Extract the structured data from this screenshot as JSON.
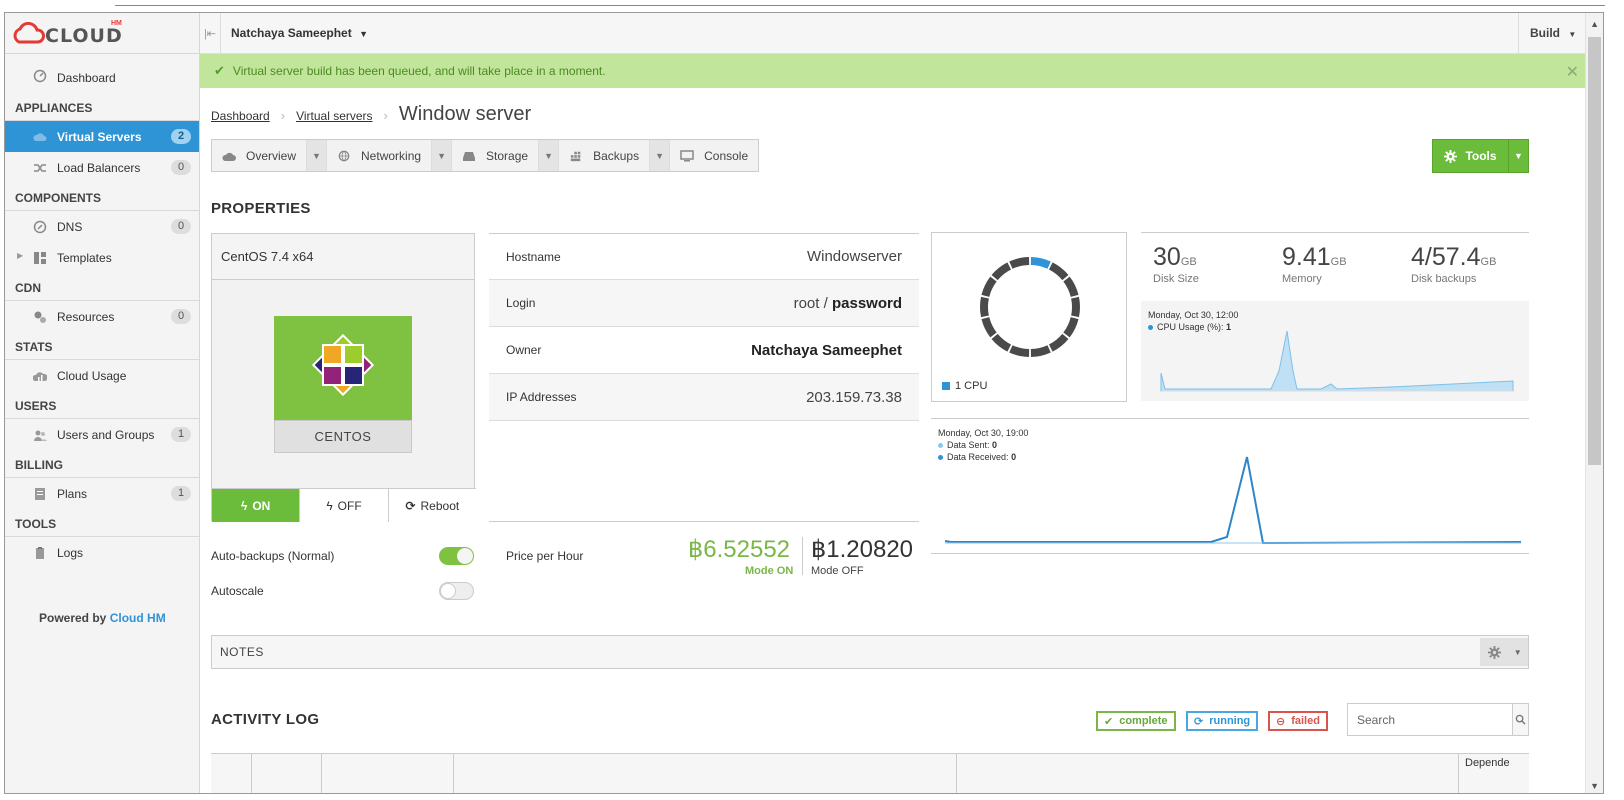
{
  "brand": {
    "name": "CLOUD",
    "superscript": "HM"
  },
  "topbar": {
    "user": "Natchaya Sameephet",
    "build": "Build"
  },
  "sidebar": {
    "dashboard": "Dashboard",
    "sections": {
      "appliances": "APPLIANCES",
      "components": "COMPONENTS",
      "cdn": "CDN",
      "stats": "STATS",
      "users": "USERS",
      "billing": "BILLING",
      "tools": "TOOLS"
    },
    "items": {
      "virtual_servers": {
        "label": "Virtual Servers",
        "count": "2"
      },
      "load_balancers": {
        "label": "Load Balancers",
        "count": "0"
      },
      "dns": {
        "label": "DNS",
        "count": "0"
      },
      "templates": {
        "label": "Templates"
      },
      "resources": {
        "label": "Resources",
        "count": "0"
      },
      "cloud_usage": {
        "label": "Cloud Usage"
      },
      "users_groups": {
        "label": "Users and Groups",
        "count": "1"
      },
      "plans": {
        "label": "Plans",
        "count": "1"
      },
      "logs": {
        "label": "Logs"
      }
    },
    "powered_prefix": "Powered by",
    "powered_link": "Cloud HM"
  },
  "alert": {
    "message": "Virtual server build has been queued, and will take place in a moment."
  },
  "breadcrumb": {
    "dashboard": "Dashboard",
    "virtual_servers": "Virtual servers",
    "current": "Window server"
  },
  "tabs": {
    "overview": "Overview",
    "networking": "Networking",
    "storage": "Storage",
    "backups": "Backups",
    "console": "Console"
  },
  "tools_label": "Tools",
  "properties": {
    "heading": "PROPERTIES",
    "os": "CentOS 7.4 x64",
    "os_logo_label": "CENTOS",
    "power": {
      "on": "ON",
      "off": "OFF",
      "reboot": "Reboot"
    },
    "hostname_label": "Hostname",
    "hostname": "Windowserver",
    "login_label": "Login",
    "login_user": "root",
    "login_sep": "/",
    "login_pass": "password",
    "owner_label": "Owner",
    "owner": "Natchaya Sameephet",
    "ip_label": "IP Addresses",
    "ip": "203.159.73.38",
    "auto_backups": "Auto-backups (Normal)",
    "auto_backups_on": true,
    "autoscale": "Autoscale",
    "autoscale_on": false,
    "price_label": "Price per Hour",
    "price_on": "฿6.52552",
    "price_on_mode": "Mode ON",
    "price_off": "฿1.20820",
    "price_off_mode": "Mode OFF"
  },
  "cpu": {
    "legend": "1 CPU",
    "segments": 14,
    "used_segments": 1
  },
  "stats": {
    "disk": {
      "value": "30",
      "unit": "GB",
      "label": "Disk Size"
    },
    "memory": {
      "value": "9.41",
      "unit": "GB",
      "label": "Memory"
    },
    "backups": {
      "value": "4/57.4",
      "unit": "GB",
      "label": "Disk backups"
    }
  },
  "cpu_chart_tip": {
    "time": "Monday, Oct 30, 12:00",
    "label": "CPU Usage (%):",
    "value": "1"
  },
  "net_chart_tip": {
    "time": "Monday, Oct 30, 19:00",
    "sent_label": "Data Sent:",
    "sent_value": "0",
    "received_label": "Data Received:",
    "received_value": "0"
  },
  "notes": {
    "heading": "NOTES"
  },
  "activity_log": {
    "heading": "ACTIVITY LOG",
    "filters": {
      "complete": "complete",
      "running": "running",
      "failed": "failed"
    },
    "search_placeholder": "Search",
    "columns": {
      "last": "Depende"
    }
  },
  "colors": {
    "accent": "#2e94d6",
    "success": "#6cbc3c",
    "alert_bg": "#c2e59c",
    "danger": "#d9534f"
  }
}
